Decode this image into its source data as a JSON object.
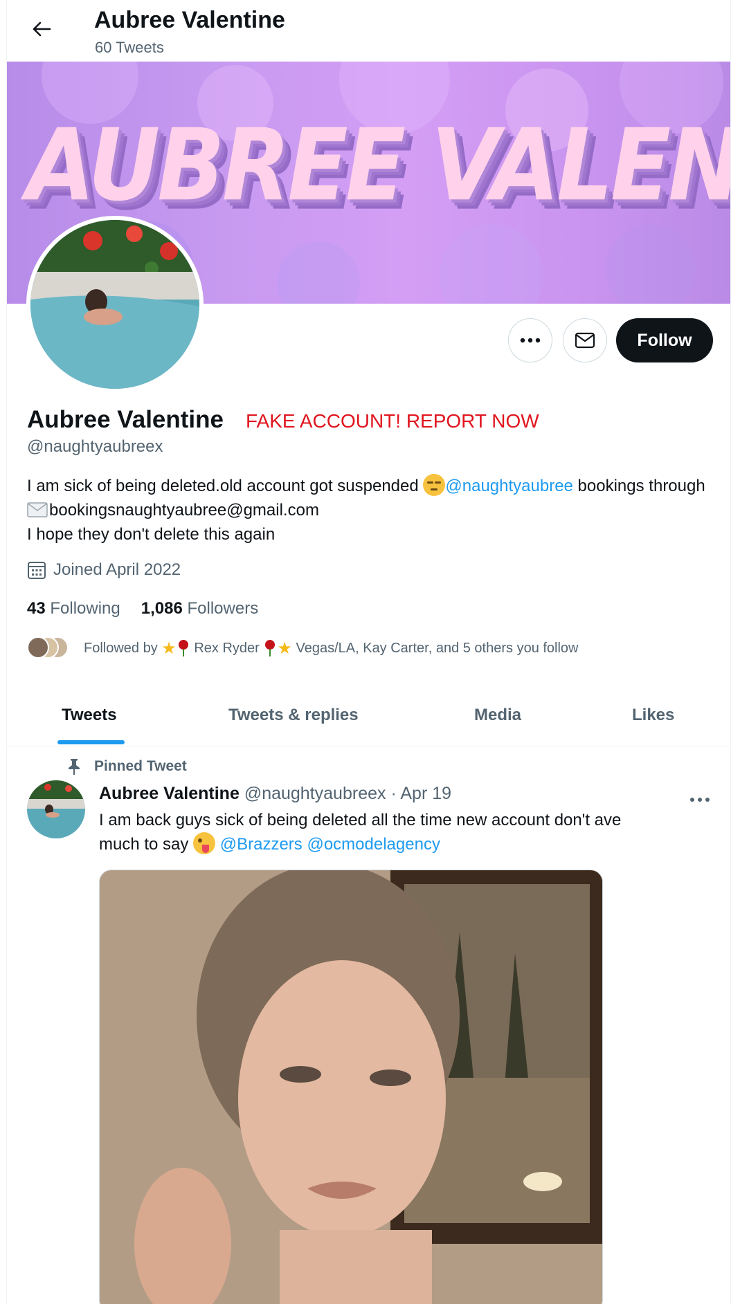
{
  "header": {
    "title": "Aubree Valentine",
    "subtitle": "60 Tweets"
  },
  "banner": {
    "text": "AUBREE VALENTINE"
  },
  "actions": {
    "follow_label": "Follow"
  },
  "profile": {
    "name": "Aubree Valentine",
    "warning": "FAKE ACCOUNT! REPORT NOW",
    "handle": "@naughtyaubreex",
    "bio_part1": "I am sick of being deleted.old account got suspended ",
    "bio_mention": "@naughtyaubree",
    "bio_part2": " bookings through ",
    "bio_email": "bookingsnaughtyaubree@gmail.com",
    "bio_line3": "I hope they don't delete this again",
    "joined": "Joined April 2022",
    "following_count": "43",
    "following_label": "Following",
    "followers_count": "1,086",
    "followers_label": "Followers",
    "followed_by_prefix": "Followed by",
    "followed_by_name1": "Rex Ryder",
    "followed_by_rest": "Vegas/LA, Kay Carter, and 5 others you follow"
  },
  "tabs": [
    {
      "label": "Tweets",
      "active": true
    },
    {
      "label": "Tweets & replies",
      "active": false
    },
    {
      "label": "Media",
      "active": false
    },
    {
      "label": "Likes",
      "active": false
    }
  ],
  "pinned_tweet": {
    "pinned_label": "Pinned Tweet",
    "author": "Aubree Valentine",
    "handle": "@naughtyaubreex",
    "separator": "·",
    "date": "Apr 19",
    "text_line1": "I am back guys sick of being deleted all the time new account don't ave",
    "text_line2": "much to say ",
    "mention1": "@Brazzers",
    "mention2": "@ocmodelagency"
  },
  "colors": {
    "accent": "#1d9bf0",
    "warning": "#e0141e",
    "follow_button": "#0f1419"
  }
}
